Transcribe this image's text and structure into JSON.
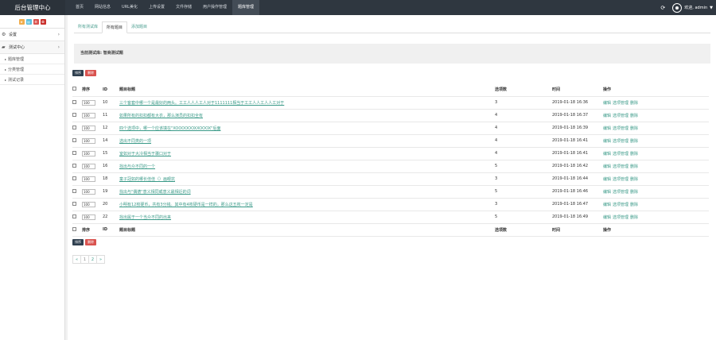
{
  "brand": "后台管理中心",
  "nav": [
    {
      "label": "首页",
      "active": false
    },
    {
      "label": "网站信息",
      "active": false
    },
    {
      "label": "URL美化",
      "active": false
    },
    {
      "label": "上传设置",
      "active": false
    },
    {
      "label": "文件存储",
      "active": false
    },
    {
      "label": "用户操作管理",
      "active": false
    },
    {
      "label": "题库管理",
      "active": true
    }
  ],
  "user": {
    "name": "欢迎, admin"
  },
  "sidebar": {
    "quick_buttons": [
      "★",
      "▤",
      "⚙",
      "✪"
    ],
    "settings_label": "设置",
    "quiz_center_label": "测试中心",
    "sub_items": [
      "题库管理",
      "分类管理",
      "测试记录"
    ]
  },
  "tabs": [
    "所有测试库",
    "所有题目",
    "添加题目"
  ],
  "current_lib": {
    "label": "当前测试库:",
    "value": "智商测试题"
  },
  "buttons": {
    "sort": "排序",
    "delete": "删除"
  },
  "table": {
    "headers": {
      "sort": "排序",
      "id": "ID",
      "title": "题目标题",
      "count": "选项数",
      "time": "时间",
      "ops": "操作"
    },
    "rows": [
      {
        "sort": "100",
        "id": "10",
        "title": "三个客套中哪一个是最好的两头。工工人人人工人对于1111111相当于工工人人工人人工对于",
        "count": "3",
        "time": "2019-01-18 16:36"
      },
      {
        "sort": "100",
        "id": "11",
        "title": "如果所有的扣扣都有大衣，那么演员的扣扣全有",
        "count": "4",
        "time": "2019-01-18 16:37"
      },
      {
        "sort": "100",
        "id": "12",
        "title": "四个选项中，哪一个应该填在\"XOOOOOOXXOOOX\"后面",
        "count": "4",
        "time": "2019-01-18 16:39"
      },
      {
        "sort": "100",
        "id": "14",
        "title": "选出不同类的一项",
        "count": "4",
        "time": "2019-01-18 16:41"
      },
      {
        "sort": "100",
        "id": "15",
        "title": "室如对于大冷相当于骤口对于",
        "count": "4",
        "time": "2019-01-18 16:41"
      },
      {
        "sort": "100",
        "id": "16",
        "title": "找出与众不同的一个",
        "count": "5",
        "time": "2019-01-18 16:42"
      },
      {
        "sort": "100",
        "id": "18",
        "title": "童子冠如的哪长佳佳（）画眼抗",
        "count": "3",
        "time": "2019-01-18 16:44"
      },
      {
        "sort": "100",
        "id": "19",
        "title": "找出与\"偶德\"意义相同或意义最相近的词",
        "count": "5",
        "time": "2019-01-18 16:46"
      },
      {
        "sort": "100",
        "id": "20",
        "title": "小明有12枚硬币，共有3分钱。其中有4枚硬币是一样的，那么这五枚一定是",
        "count": "3",
        "time": "2019-01-18 16:47"
      },
      {
        "sort": "100",
        "id": "22",
        "title": "找出属于一个当众不同的出来",
        "count": "5",
        "time": "2019-01-18 16:49"
      }
    ],
    "ops": [
      "编辑",
      "选项管理",
      "删除"
    ]
  },
  "pager": [
    "«",
    "1",
    "2",
    "»"
  ]
}
